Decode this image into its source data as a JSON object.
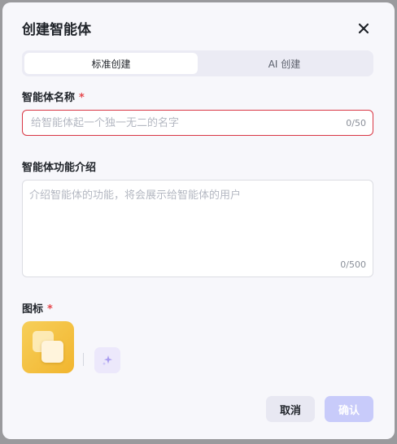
{
  "dialog": {
    "title": "创建智能体",
    "close_icon": "close-icon"
  },
  "tabs": [
    {
      "label": "标准创建",
      "active": true
    },
    {
      "label": "AI 创建",
      "active": false
    }
  ],
  "name_field": {
    "label": "智能体名称",
    "required_mark": "*",
    "placeholder": "给智能体起一个独一无二的名字",
    "value": "",
    "counter": "0/50"
  },
  "desc_field": {
    "label": "智能体功能介绍",
    "placeholder": "介绍智能体的功能，将会展示给智能体的用户",
    "value": "",
    "counter": "0/500"
  },
  "icon_field": {
    "label": "图标",
    "required_mark": "*",
    "avatar_icon": "stacked-squares-icon",
    "generate_icon": "sparkle-icon"
  },
  "footer": {
    "cancel_label": "取消",
    "confirm_label": "确认"
  },
  "colors": {
    "accent": "#c8cbfa",
    "error": "#e5484d",
    "icon_gradient_start": "#f7cf5a",
    "icon_gradient_end": "#f1b52e"
  }
}
